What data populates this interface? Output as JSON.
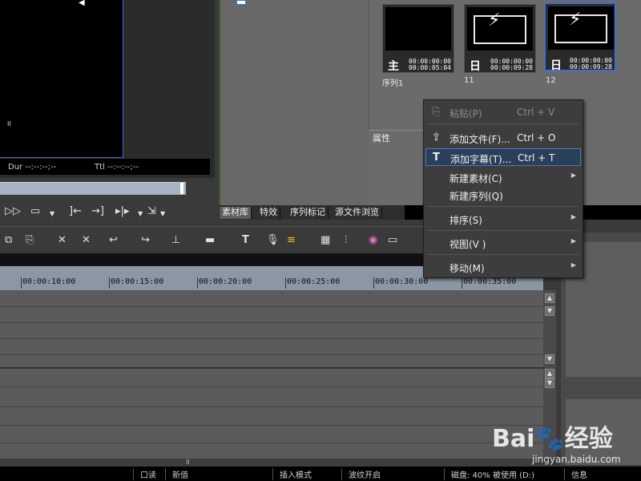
{
  "preview": {
    "dur_label": "Dur",
    "dur_value": "--:--:--;--",
    "ttl_label": "Ttl",
    "ttl_value": "--:--:--;--",
    "pause_glyph": "II"
  },
  "bin": {
    "attributes_label": "属性",
    "tabs": [
      "素材库",
      "特效",
      "序列标记",
      "源文件浏览"
    ],
    "clips": [
      {
        "name": "序列1",
        "kind_glyph": "主",
        "tc_in": "00:00:00:00",
        "tc_out": "00:00:05:04",
        "type": "sequence",
        "selected": false
      },
      {
        "name": "11",
        "kind_glyph": "日",
        "tc_in": "00:00:00:00",
        "tc_out": "00:00:09:28",
        "type": "title",
        "selected": false
      },
      {
        "name": "12",
        "kind_glyph": "日",
        "tc_in": "00:00:00:00",
        "tc_out": "00:00:09:28",
        "type": "title",
        "selected": true
      }
    ]
  },
  "context_menu": {
    "items": [
      {
        "label": "粘贴(P)",
        "shortcut": "Ctrl + V",
        "icon": "paste-icon",
        "glyph": "⎘",
        "disabled": true,
        "submenu": false
      },
      {
        "label": "添加文件(F)...",
        "shortcut": "Ctrl + O",
        "icon": "add-file-icon",
        "glyph": "⇪",
        "disabled": false,
        "submenu": false
      },
      {
        "label": "添加字幕(T)...",
        "shortcut": "Ctrl + T",
        "icon": "title-text-icon",
        "glyph": "T",
        "disabled": false,
        "submenu": false,
        "hover": true
      },
      {
        "label": "新建素材(C)",
        "shortcut": "",
        "icon": "",
        "glyph": "",
        "disabled": false,
        "submenu": true
      },
      {
        "label": "新建序列(Q)",
        "shortcut": "",
        "icon": "",
        "glyph": "",
        "disabled": false,
        "submenu": false
      },
      {
        "label": "排序(S)",
        "shortcut": "",
        "icon": "",
        "glyph": "",
        "disabled": false,
        "submenu": true
      },
      {
        "label": "视图(V )",
        "shortcut": "",
        "icon": "",
        "glyph": "",
        "disabled": false,
        "submenu": true
      },
      {
        "label": "移动(M)",
        "shortcut": "",
        "icon": "",
        "glyph": "",
        "disabled": false,
        "submenu": true
      }
    ]
  },
  "timeline": {
    "ticks": [
      "00:00:10:00",
      "00:00:15:00",
      "00:00:20:00",
      "00:00:25:00",
      "00:00:30:00",
      "00:00:35:00"
    ]
  },
  "status_bar": {
    "items": [
      "口读",
      "新值",
      "插入模式",
      "波纹开启",
      "磁盘: 40% 被使用 (D:)",
      "信息"
    ]
  },
  "watermark": {
    "logo_text": "Bai",
    "logo_cn": "经验",
    "site": "jingyan.baidu.com"
  }
}
